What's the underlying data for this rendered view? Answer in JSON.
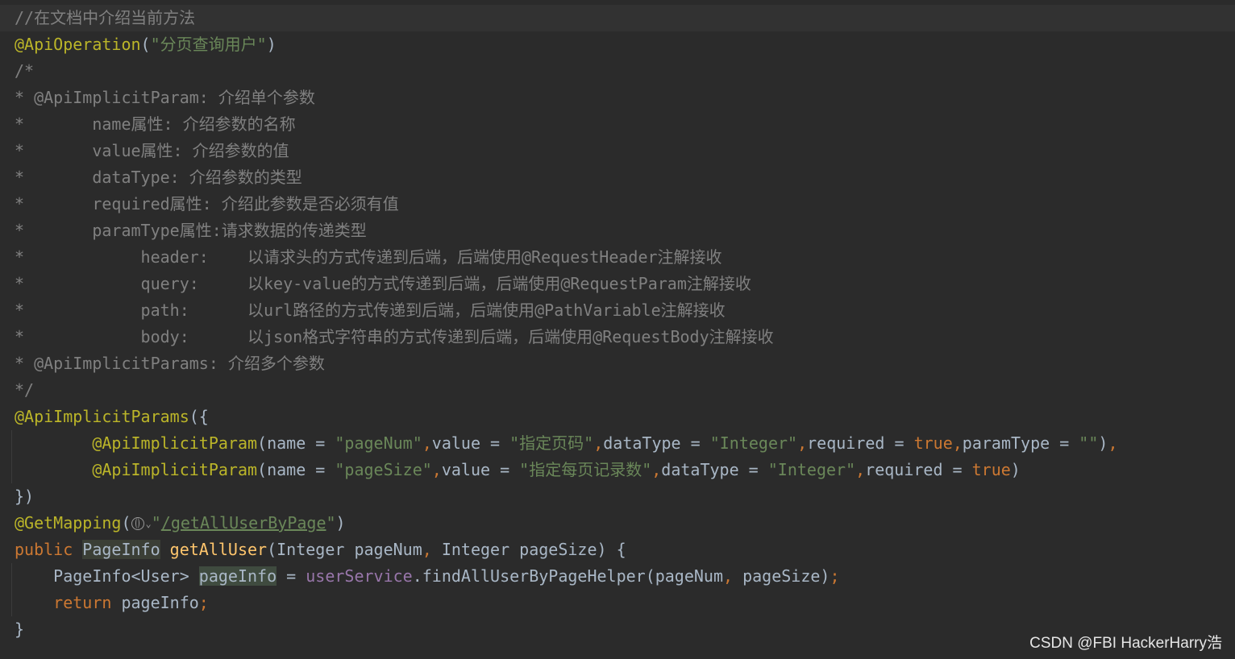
{
  "colors": {
    "background": "#2b2b2b",
    "current_line": "#323232",
    "comment": "#808080",
    "annotation": "#bbb529",
    "string": "#6a8759",
    "keyword": "#cc7832",
    "method": "#ffc66d",
    "field": "#9876aa",
    "plain": "#a9b7c6"
  },
  "icons": {
    "url_gutter": "globe-icon",
    "url_dropdown": "chevron-down-icon"
  },
  "code": {
    "l1": "//在文档中介绍当前方法",
    "l2_ann": "@ApiOperation",
    "l2_p1": "(",
    "l2_str": "\"分页查询用户\"",
    "l2_p2": ")",
    "l3": "/*",
    "l4": "* @ApiImplicitParam: 介绍单个参数",
    "l5": "*       name属性: 介绍参数的名称",
    "l6": "*       value属性: 介绍参数的值",
    "l7": "*       dataType: 介绍参数的类型",
    "l8": "*       required属性: 介绍此参数是否必须有值",
    "l9": "*       paramType属性:请求数据的传递类型",
    "l10": "*            header:    以请求头的方式传递到后端，后端使用@RequestHeader注解接收",
    "l11": "*            query:     以key-value的方式传递到后端，后端使用@RequestParam注解接收",
    "l12": "*            path:      以url路径的方式传递到后端，后端使用@PathVariable注解接收",
    "l13": "*            body:      以json格式字符串的方式传递到后端，后端使用@RequestBody注解接收",
    "l14": "* @ApiImplicitParams: 介绍多个参数",
    "l15": "*/",
    "l16_ann": "@ApiImplicitParams",
    "l16_p": "({",
    "l17_indent": "        ",
    "l17_ann": "@ApiImplicitParam",
    "l17_a": "(name = ",
    "l17_s1": "\"pageNum\"",
    "l17_c1": ",",
    "l17_b": "value = ",
    "l17_s2": "\"指定页码\"",
    "l17_c2": ",",
    "l17_c": "dataType = ",
    "l17_s3": "\"Integer\"",
    "l17_c3": ",",
    "l17_d": "required = ",
    "l17_kw": "true",
    "l17_c4": ",",
    "l17_e": "paramType = ",
    "l17_s4": "\"\"",
    "l17_f": ")",
    "l17_c5": ",",
    "l18_indent": "        ",
    "l18_ann": "@ApiImplicitParam",
    "l18_a": "(name = ",
    "l18_s1": "\"pageSize\"",
    "l18_c1": ",",
    "l18_b": "value = ",
    "l18_s2": "\"指定每页记录数\"",
    "l18_c2": ",",
    "l18_c": "dataType = ",
    "l18_s3": "\"Integer\"",
    "l18_c3": ",",
    "l18_d": "required = ",
    "l18_kw": "true",
    "l18_f": ")",
    "l19": "})",
    "l20_ann": "@GetMapping",
    "l20_p1": "(",
    "l20_q1": "\"",
    "l20_url": "/getAllUserByPage",
    "l20_q2": "\"",
    "l20_p2": ")",
    "l21_kw": "public",
    "l21_sp1": " ",
    "l21_type": "PageInfo",
    "l21_sp2": " ",
    "l21_fn": "getAllUser",
    "l21_a": "(Integer pageNum",
    "l21_comma": ",",
    "l21_b": " Integer pageSize) {",
    "l22_indent": "    ",
    "l22_type": "PageInfo<User> ",
    "l22_var": "pageInfo",
    "l22_eq": " = ",
    "l22_fld": "userService",
    "l22_call": ".findAllUserByPageHelper(pageNum",
    "l22_comma": ",",
    "l22_rest": " pageSize)",
    "l22_semi": ";",
    "l23_indent": "    ",
    "l23_kw": "return",
    "l23_rest": " pageInfo",
    "l23_semi": ";",
    "l24": "}"
  },
  "watermark": "CSDN @FBI HackerHarry浩"
}
